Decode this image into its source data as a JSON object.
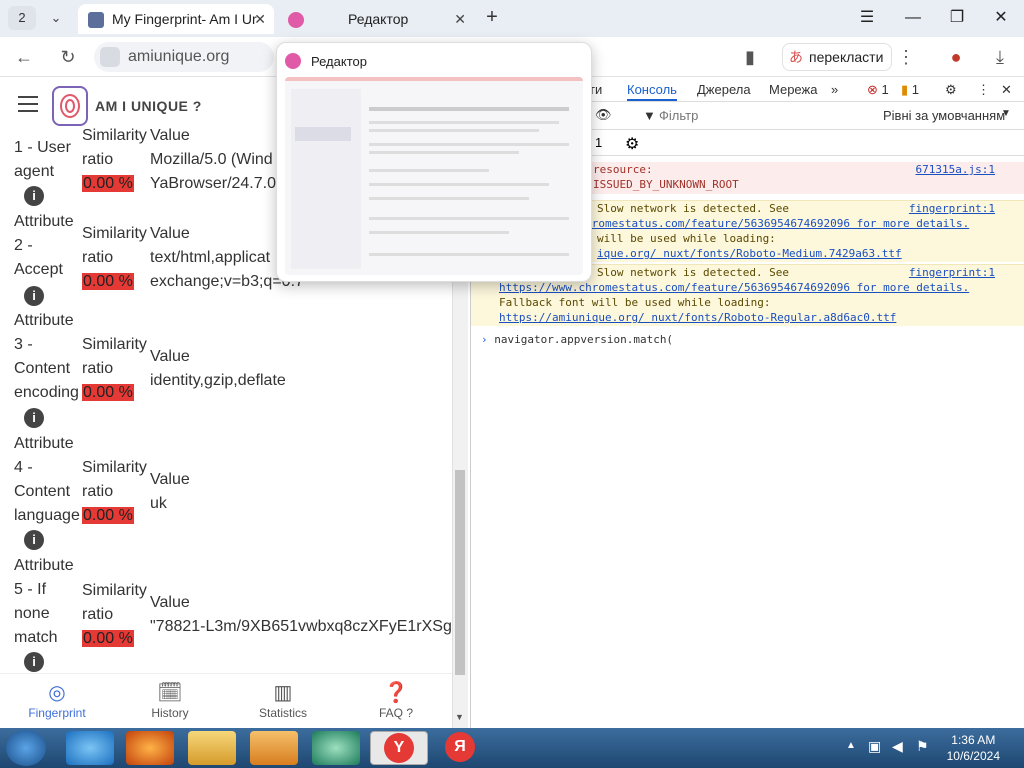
{
  "browser": {
    "tab_count": "2",
    "tabs": [
      {
        "title": "My Fingerprint- Am I Ur"
      },
      {
        "title": "Редактор"
      }
    ],
    "address": "amiunique.org",
    "translate_label": "перекласти"
  },
  "page": {
    "brand": "AM I UNIQUE ?",
    "rows": [
      {
        "attr": [
          "1 - User",
          "agent"
        ],
        "sim": [
          "Similarity",
          "ratio"
        ],
        "pct": "0.00 %",
        "value": [
          "Value",
          "Mozilla/5.0 (Wind",
          "YaBrowser/24.7.0"
        ]
      },
      {
        "attr": [
          "Attribute",
          "2 -",
          "Accept"
        ],
        "sim": [
          "Similarity",
          "ratio"
        ],
        "pct": "0.00 %",
        "value": [
          "Value",
          "text/html,applicat",
          "exchange;v=b3;q=0.7"
        ]
      },
      {
        "attr": [
          "Attribute",
          "3 -",
          "Content",
          "encoding"
        ],
        "sim": [
          "Similarity",
          "ratio"
        ],
        "pct": "0.00 %",
        "value": [
          "Value",
          "identity,gzip,deflate"
        ]
      },
      {
        "attr": [
          "Attribute",
          "4 -",
          "Content",
          "language"
        ],
        "sim": [
          "Similarity",
          "ratio"
        ],
        "pct": "0.00 %",
        "value": [
          "Value",
          "uk"
        ]
      },
      {
        "attr": [
          "Attribute",
          "5 - If",
          "none",
          "match"
        ],
        "sim": [
          "Similarity",
          "ratio"
        ],
        "pct": "0.00 %",
        "value": [
          "Value",
          "\"78821-L3m/9XB651vwbxq8czXFyE1rXSg\""
        ]
      }
    ],
    "bottom_nav": [
      {
        "label": "Fingerprint",
        "icon": "fingerprint-icon",
        "active": true
      },
      {
        "label": "History",
        "icon": "history-icon",
        "active": false
      },
      {
        "label": "Statistics",
        "icon": "bar-chart-icon",
        "active": false
      },
      {
        "label": "FAQ ?",
        "icon": "help-icon",
        "active": false
      }
    ]
  },
  "devtools": {
    "tabs": [
      "ти",
      "Консоль",
      "Джерела",
      "Мережа"
    ],
    "active_tab": "Консоль",
    "error_count": "1",
    "warning_count": "1",
    "filter_placeholder": "Фільтр",
    "levels": "Рівні за умовчанням",
    "issues_count": "1",
    "messages": [
      {
        "type": "error",
        "lines": [
          "resource:",
          "ISSUED_BY_UNKNOWN_ROOT"
        ],
        "source": "671315a.js:1"
      },
      {
        "type": "warning",
        "lines": [
          "Slow network is detected. See",
          "https://www.chromestatus.com/feature/5636954674692096 for more details.",
          "will be used while loading:",
          "ique.org/ nuxt/fonts/Roboto-Medium.7429a63.ttf"
        ],
        "source": "fingerprint:1"
      },
      {
        "type": "warning",
        "lines": [
          "Slow network is detected. See",
          "https://www.chromestatus.com/feature/5636954674692096 for more details.",
          "Fallback font will be used while loading:",
          "https://amiunique.org/ nuxt/fonts/Roboto-Regular.a8d6ac0.ttf"
        ],
        "source": "fingerprint:1"
      }
    ],
    "input": "navigator.appversion.match("
  },
  "popup": {
    "title": "Редактор"
  },
  "taskbar": {
    "time": "1:36 AM",
    "date": "10/6/2024"
  },
  "colors": {
    "accent": "#3f6fd8",
    "bad_ratio": "#e53935",
    "brand_purple": "#7b63b5"
  }
}
